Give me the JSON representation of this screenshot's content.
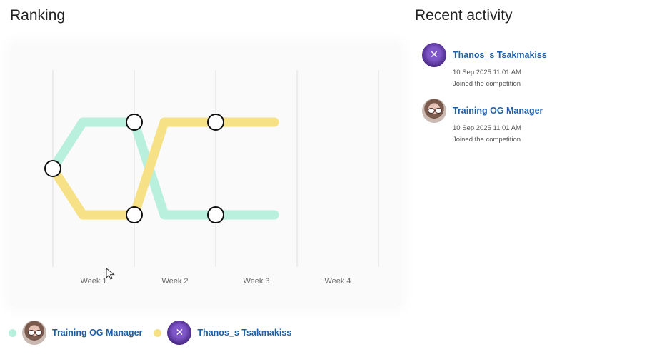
{
  "ranking": {
    "title": "Ranking"
  },
  "chart_data": {
    "type": "bump",
    "x": [
      "Week 1",
      "Week 2",
      "Week 3",
      "Week 4"
    ],
    "ranks_count": 2,
    "start_rank": 1.5,
    "series": [
      {
        "name": "Training OG Manager",
        "color": "#b9efdd",
        "ranks": [
          1,
          2,
          2
        ]
      },
      {
        "name": "Thanos_s Tsakmakiss",
        "color": "#f6e186",
        "ranks": [
          2,
          1,
          1
        ]
      }
    ],
    "grid": true,
    "legend_position": "bottom-left"
  },
  "legend": [
    {
      "name": "Training OG Manager",
      "color": "#b9efdd",
      "avatar": "person-avatar"
    },
    {
      "name": "Thanos_s Tsakmakiss",
      "color": "#f6e186",
      "avatar": "brand-avatar"
    }
  ],
  "activity": {
    "title": "Recent activity",
    "items": [
      {
        "name": "Thanos_s Tsakmakiss",
        "time": "10 Sep 2025 11:01 AM",
        "action": "Joined the competition",
        "avatar": "brand-avatar"
      },
      {
        "name": "Training OG Manager",
        "time": "10 Sep 2025 11:01 AM",
        "action": "Joined the competition",
        "avatar": "person-avatar"
      }
    ]
  },
  "avatar_mark": "✕"
}
